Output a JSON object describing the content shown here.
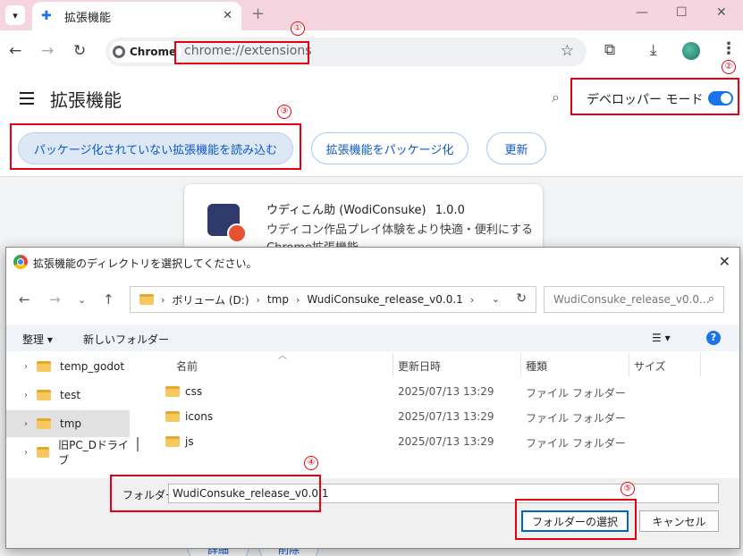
{
  "browser": {
    "tab_title": "拡張機能",
    "url": "chrome://extensions",
    "chip_label": "Chrome"
  },
  "extensions_page": {
    "title": "拡張機能",
    "dev_mode_label": "デベロッパー モード",
    "dev_mode_on": true,
    "buttons": {
      "load_unpacked": "パッケージ化されていない拡張機能を読み込む",
      "pack": "拡張機能をパッケージ化",
      "update": "更新"
    },
    "card": {
      "name": "ウディこん助 (WodiConsuke)",
      "version": "1.0.0",
      "description": "ウディコン作品プレイ体験をより快適・便利にするChrome拡張機能"
    },
    "card_buttons": [
      "詳細",
      "削除"
    ]
  },
  "dialog": {
    "title": "拡張機能のディレクトリを選択してください。",
    "breadcrumb": [
      "ボリューム (D:)",
      "tmp",
      "WudiConsuke_release_v0.0.1"
    ],
    "search_placeholder": "WudiConsuke_release_v0.0...",
    "commands": {
      "organize": "整理",
      "new_folder": "新しいフォルダー"
    },
    "tree": [
      {
        "label": "temp_godot",
        "selected": false
      },
      {
        "label": "test",
        "selected": false
      },
      {
        "label": "tmp",
        "selected": true
      },
      {
        "label": "旧PC_Dドライブ",
        "selected": false
      }
    ],
    "columns": {
      "name": "名前",
      "date": "更新日時",
      "type": "種類",
      "size": "サイズ"
    },
    "files": [
      {
        "name": "css",
        "date": "2025/07/13 13:29",
        "type": "ファイル フォルダー"
      },
      {
        "name": "icons",
        "date": "2025/07/13 13:29",
        "type": "ファイル フォルダー"
      },
      {
        "name": "js",
        "date": "2025/07/13 13:29",
        "type": "ファイル フォルダー"
      }
    ],
    "folder_label": "フォルダー:",
    "folder_value": "WudiConsuke_release_v0.0.1",
    "select_button": "フォルダーの選択",
    "cancel_button": "キャンセル"
  },
  "annotations": {
    "n1": "①",
    "n2": "②",
    "n3": "③",
    "n4": "④",
    "n5": "⑤",
    "color": "#e60012"
  },
  "colors": {
    "tabstrip": "#f5d6e0",
    "accent": "#1a73e8",
    "link_blue": "#0b57d0"
  }
}
